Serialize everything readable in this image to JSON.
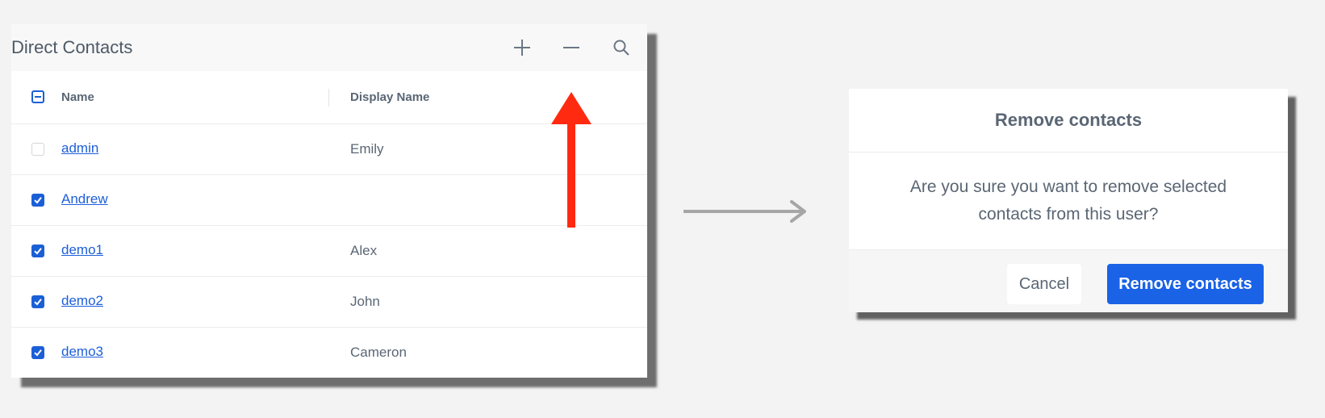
{
  "contacts_panel": {
    "title": "Direct Contacts",
    "icons": [
      "plus-icon",
      "minus-icon",
      "search-icon"
    ],
    "columns": [
      "Name",
      "Display Name"
    ],
    "rows": [
      {
        "name": "admin",
        "display_name": "Emily",
        "checked": false
      },
      {
        "name": "Andrew",
        "display_name": "",
        "checked": true
      },
      {
        "name": "demo1",
        "display_name": "Alex",
        "checked": true
      },
      {
        "name": "demo2",
        "display_name": "John",
        "checked": true
      },
      {
        "name": "demo3",
        "display_name": "Cameron",
        "checked": true
      }
    ]
  },
  "annotation": {
    "arrow_color": "#ff2a10"
  },
  "dialog": {
    "title": "Remove contacts",
    "message": "Are you sure you want to remove selected contacts from this user?",
    "cancel_label": "Cancel",
    "confirm_label": "Remove contacts"
  },
  "colors": {
    "accent": "#1a62e6",
    "link": "#1e5fd9",
    "text": "#5a6674",
    "background": "#f3f3f3"
  }
}
